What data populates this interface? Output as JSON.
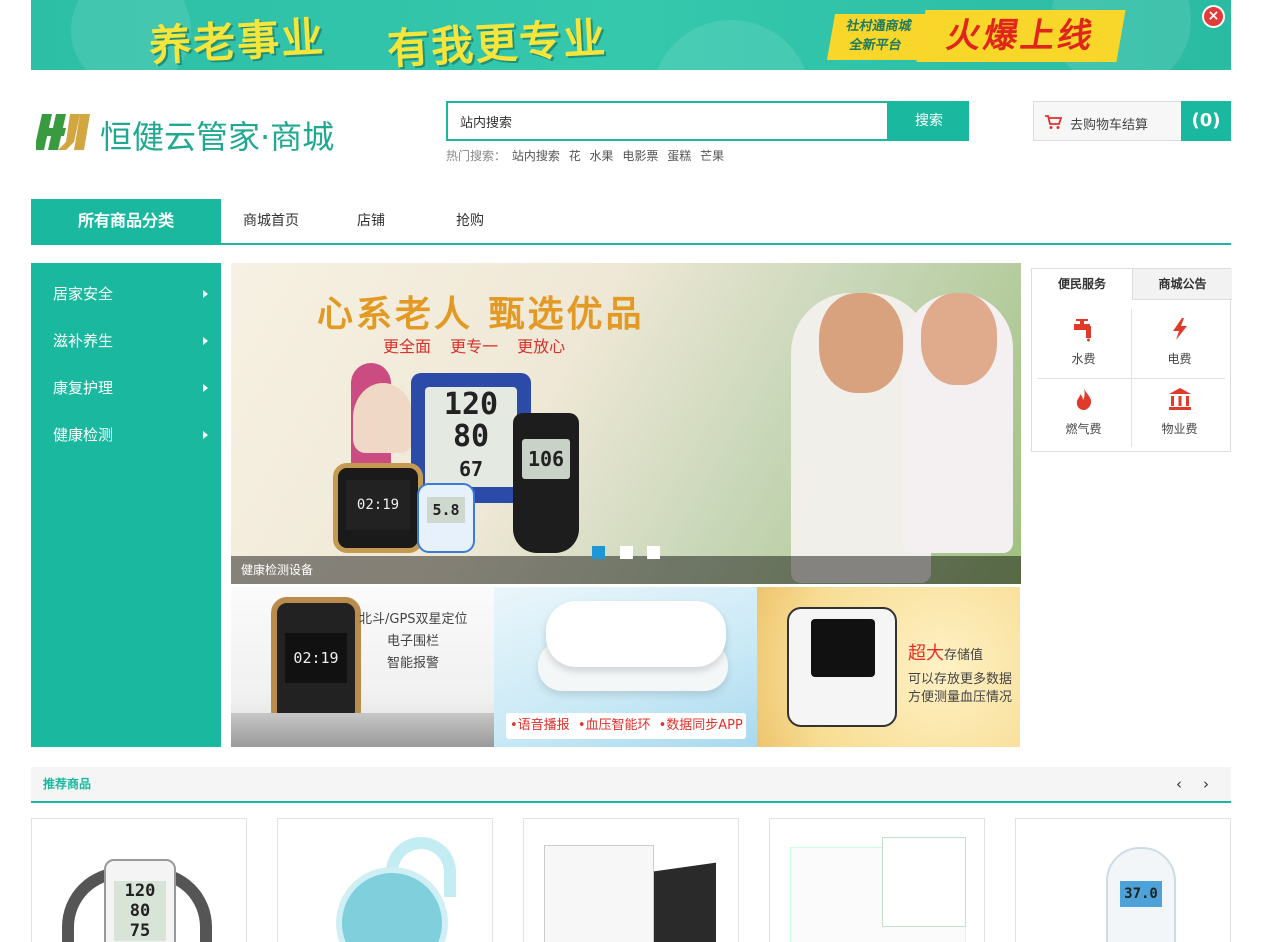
{
  "top_banner": {
    "slogan_left": "养老事业",
    "slogan_right": "有我更专业",
    "badge_line1": "社村通商城",
    "badge_line2": "全新平台",
    "highlight": "火爆上线",
    "close_symbol": "×"
  },
  "header": {
    "logo_text": "恒健云管家·商城",
    "search": {
      "value": "站内搜索",
      "button": "搜索"
    },
    "hot_search": {
      "label": "热门搜索：",
      "items": [
        "站内搜索",
        "花",
        "水果",
        "电影票",
        "蛋糕",
        "芒果"
      ]
    },
    "cart": {
      "label": "去购物车结算",
      "count": "(0)"
    }
  },
  "nav": {
    "all_categories": "所有商品分类",
    "links": [
      "商城首页",
      "店铺",
      "抢购"
    ]
  },
  "sidebar": {
    "items": [
      "居家安全",
      "滋补养生",
      "康复护理",
      "健康检测"
    ]
  },
  "slider": {
    "title": "心系老人 甄选优品",
    "subtitle": "更全面 更专一 更放心",
    "caption": "健康检测设备",
    "device_readings": {
      "bp_top": "120",
      "bp_mid": "80",
      "bp_bottom": "67",
      "glucose": "106",
      "watch_time": "02:19",
      "meter": "5.8"
    },
    "slide_count": 3,
    "active_slide": 1
  },
  "promos": [
    {
      "lines": [
        "北斗/GPS双星定位",
        "电子围栏",
        "智能报警"
      ],
      "watch_time": "02:19"
    },
    {
      "lines": [
        "•语音播报",
        "•血压智能环",
        "•数据同步APP"
      ]
    },
    {
      "big": "超大",
      "lines": [
        "存储值",
        "可以存放更多数据",
        "方便测量血压情况"
      ]
    }
  ],
  "services": {
    "tabs": [
      "便民服务",
      "商城公告"
    ],
    "items": [
      {
        "label": "水费",
        "icon": "faucet-icon"
      },
      {
        "label": "电费",
        "icon": "lightning-icon"
      },
      {
        "label": "燃气费",
        "icon": "flame-icon"
      },
      {
        "label": "物业费",
        "icon": "building-icon"
      }
    ]
  },
  "recommend": {
    "title": "推荐商品",
    "prev": "‹",
    "next": "›",
    "products": [
      {
        "name": "blood-pressure-monitor",
        "reading_top": "120",
        "reading_mid": "80",
        "reading_bottom": "75"
      },
      {
        "name": "smart-bracelet"
      },
      {
        "name": "alarm-kit"
      },
      {
        "name": "home-health-kit"
      },
      {
        "name": "infrared-thermometer",
        "reading": "37.0"
      }
    ]
  },
  "colors": {
    "brand": "#1ab99f",
    "banner_yellow": "#f6e53a",
    "alert_red": "#e2302a"
  }
}
